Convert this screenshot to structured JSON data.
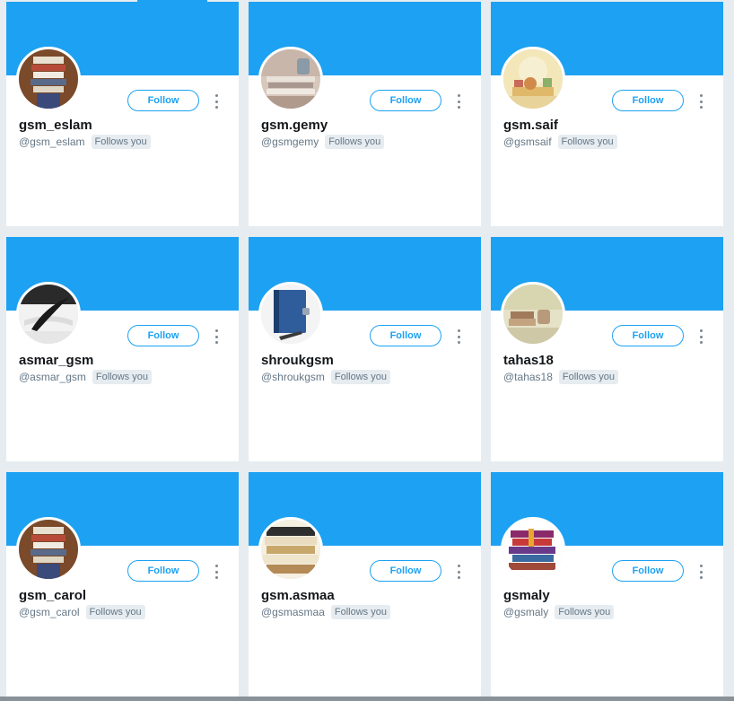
{
  "colors": {
    "accent": "#1da1f2",
    "background": "#e6ecf0"
  },
  "cards": [
    {
      "display_name": "gsm_eslam",
      "handle": "@gsm_eslam",
      "badge": "Follows you",
      "follow_label": "Follow",
      "avatar": "books-stack-photo"
    },
    {
      "display_name": "gsm.gemy",
      "handle": "@gsmgemy",
      "badge": "Follows you",
      "follow_label": "Follow",
      "avatar": "books-on-table-photo"
    },
    {
      "display_name": "gsm.saif",
      "handle": "@gsmsaif",
      "badge": "Follows you",
      "follow_label": "Follow",
      "avatar": "cartoon-reading-photo"
    },
    {
      "display_name": "asmar_gsm",
      "handle": "@asmar_gsm",
      "badge": "Follows you",
      "follow_label": "Follow",
      "avatar": "quill-and-book-photo"
    },
    {
      "display_name": "shroukgsm",
      "handle": "@shroukgsm",
      "badge": "Follows you",
      "follow_label": "Follow",
      "avatar": "blue-notebook-photo"
    },
    {
      "display_name": "tahas18",
      "handle": "@tahas18",
      "badge": "Follows you",
      "follow_label": "Follow",
      "avatar": "coffee-and-books-photo"
    },
    {
      "display_name": "gsm_carol",
      "handle": "@gsm_carol",
      "badge": "Follows you",
      "follow_label": "Follow",
      "avatar": "books-stack-photo"
    },
    {
      "display_name": "gsm.asmaa",
      "handle": "@gsmasmaa",
      "badge": "Follows you",
      "follow_label": "Follow",
      "avatar": "open-books-photo"
    },
    {
      "display_name": "gsmaly",
      "handle": "@gsmaly",
      "badge": "Follows you",
      "follow_label": "Follow",
      "avatar": "colorful-books-photo"
    }
  ]
}
